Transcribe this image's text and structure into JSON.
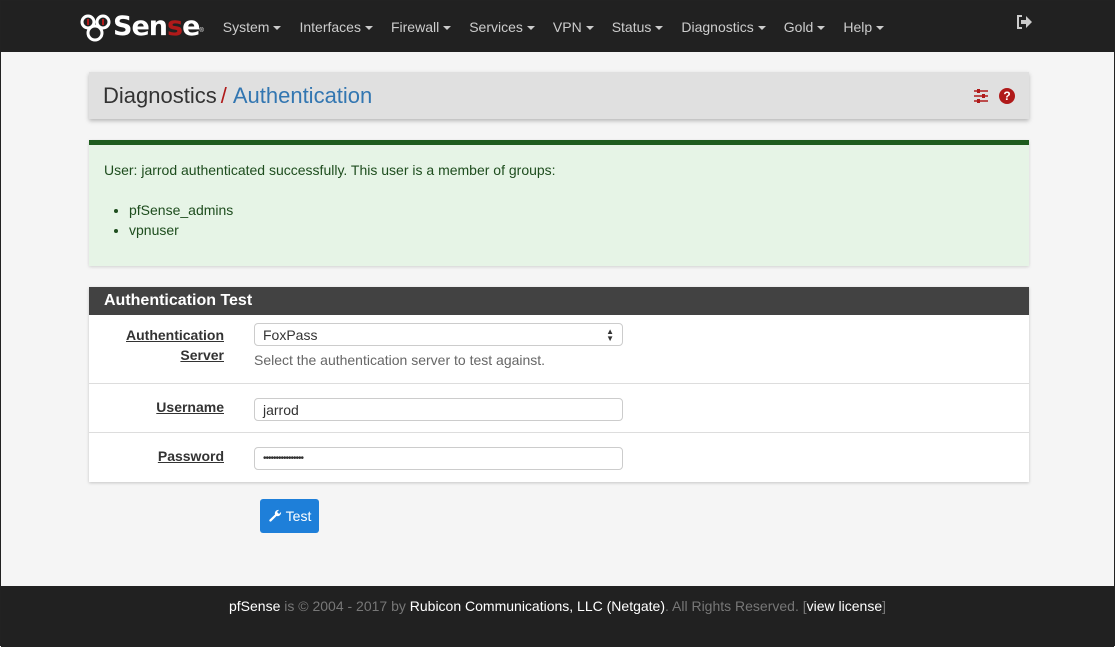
{
  "nav": {
    "logo": "pfSense",
    "menu": [
      "System",
      "Interfaces",
      "Firewall",
      "Services",
      "VPN",
      "Status",
      "Diagnostics",
      "Gold",
      "Help"
    ]
  },
  "breadcrumb": {
    "parent": "Diagnostics",
    "separator": "/",
    "current": "Authentication"
  },
  "alert": {
    "message": "User: jarrod authenticated successfully. This user is a member of groups:",
    "groups": [
      "pfSense_admins",
      "vpnuser"
    ]
  },
  "panel": {
    "title": "Authentication Test",
    "server_label": "Authentication Server",
    "server_value": "FoxPass",
    "server_help": "Select the authentication server to test against.",
    "username_label": "Username",
    "username_value": "jarrod",
    "password_label": "Password",
    "password_value": "••••••••••••••••"
  },
  "test_button": "Test",
  "footer": {
    "brand": "pfSense",
    "text1": " is © 2004 - 2017 by ",
    "company": "Rubicon Communications, LLC (Netgate)",
    "text2": ". All Rights Reserved. [",
    "license": "view license",
    "text3": "]"
  },
  "colors": {
    "accent": "#b01a1a",
    "link": "#3276b1",
    "button": "#1e7fd9",
    "success_border": "#1e5c1e"
  }
}
